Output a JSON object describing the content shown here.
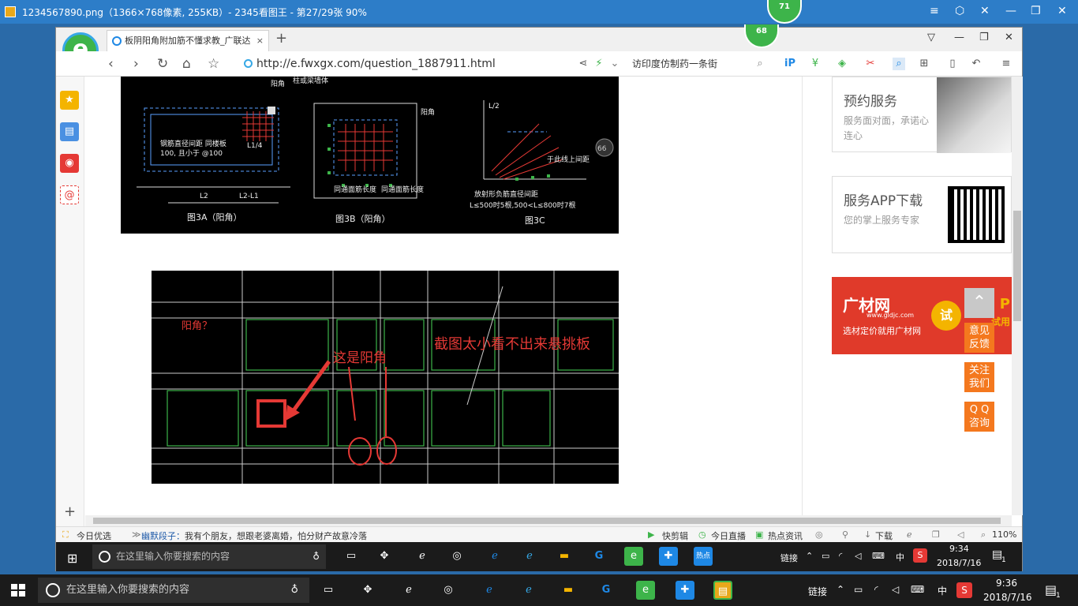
{
  "viewer": {
    "title": "1234567890.png（1366×768像素, 255KB）- 2345看图王 - 第27/29张 90%",
    "badge_top": "71",
    "controls": [
      "≡",
      "⬡",
      "✕",
      "—",
      "❐",
      "✕"
    ]
  },
  "browser": {
    "badge": "68",
    "logo": "e",
    "tab_title": "板阴阳角附加筋不懂求教_广联达",
    "tab_close": "×",
    "new_tab": "+",
    "url": "http://e.fwxgx.com/question_1887911.html",
    "search_placeholder": "访印度仿制药一条街",
    "window_controls": [
      "▽",
      "—",
      "❐",
      "✕"
    ]
  },
  "cad_top": {
    "labels": [
      "阳角",
      "柱或梁墙体",
      "钢筋直径间距 同楼板",
      "100, 且小于 @100",
      "L1/4",
      "L2",
      "L2-L1",
      "图3A（阳角）",
      "阳角",
      "同通面筋长度",
      "同通面筋长度",
      "图3B（阳角）",
      "L/2",
      "放射形负筋直径间距",
      "L≤500时5根,500<L≤800时7根",
      "图3C",
      "于此线上间距",
      "66"
    ]
  },
  "cad_bottom": {
    "question": "阳角？",
    "annotation1": "这是阳角",
    "annotation2": "截图太小看不出来悬挑板"
  },
  "sidebar_right": {
    "card1": {
      "title": "预约服务",
      "desc": "服务面对面，承诺心连心"
    },
    "card2": {
      "title": "服务APP下载",
      "desc": "您的掌上服务专家"
    },
    "ad": {
      "brand": "广材网",
      "brand_sub": "www.gldjc.com",
      "slogan": "选材定价就用广材网",
      "try": "试",
      "tail": "P",
      "tail2": "试用"
    },
    "buttons": [
      {
        "line1": "意见",
        "line2": "反馈"
      },
      {
        "line1": "关注",
        "line2": "我们"
      },
      {
        "line1": "Q Q",
        "line2": "咨询"
      }
    ]
  },
  "statusbar": {
    "today": "今日优选",
    "joke_label": "幽默段子：",
    "joke": "我有个朋友，想跟老婆离婚，怕分财产故意冷落",
    "items": [
      "快剪辑",
      "今日直播",
      "热点资讯",
      "下载"
    ],
    "zoom": "110%"
  },
  "inner_taskbar": {
    "search_placeholder": "在这里输入你要搜索的内容",
    "link": "链接",
    "ime": "中",
    "time": "9:34",
    "date": "2018/7/16",
    "notif": "1"
  },
  "outer_taskbar": {
    "search_placeholder": "在这里输入你要搜索的内容",
    "link": "链接",
    "ime": "中",
    "time": "9:36",
    "date": "2018/7/16",
    "notif": "1"
  }
}
